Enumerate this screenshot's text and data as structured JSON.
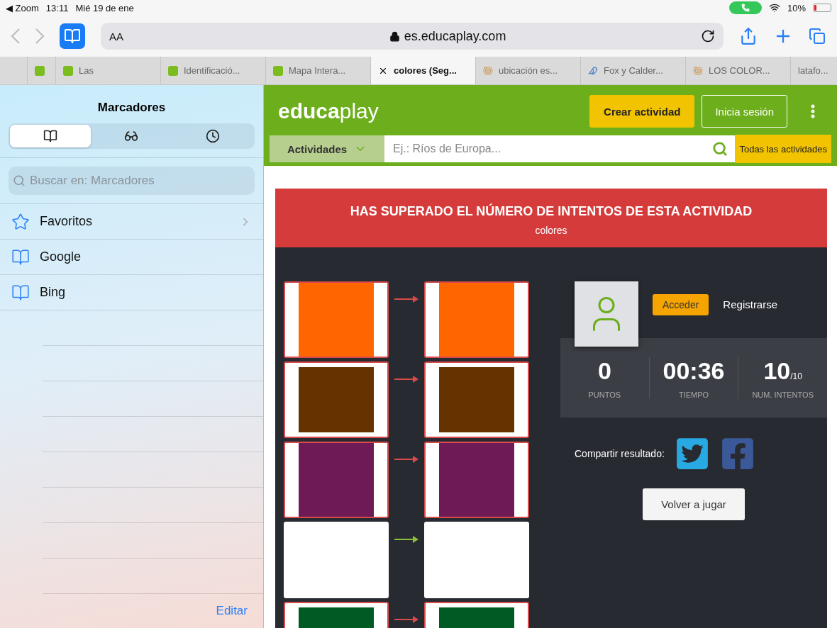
{
  "status_bar": {
    "back_app": "◀ Zoom",
    "time": "13:11",
    "date": "Mié 19 de ene",
    "battery": "10%"
  },
  "toolbar": {
    "text_size": "AA",
    "url": "es.educaplay.com"
  },
  "tabs": [
    {
      "kind": "site",
      "selected": false
    },
    {
      "kind": "site",
      "label": "Las",
      "selected": false
    },
    {
      "kind": "site",
      "label": "Identificació...",
      "selected": false
    },
    {
      "kind": "site",
      "label": "Mapa Intera...",
      "selected": false
    },
    {
      "kind": "closable",
      "label": "colores (Seg...",
      "selected": true
    },
    {
      "kind": "shell",
      "label": "ubicación es...",
      "selected": false
    },
    {
      "kind": "bird",
      "label": "Fox y Calder...",
      "selected": false
    },
    {
      "kind": "shell",
      "label": "LOS COLOR...",
      "selected": false
    },
    {
      "kind": "plain",
      "label": "latafo...",
      "selected": false
    }
  ],
  "sidebar": {
    "title": "Marcadores",
    "segments": [
      {
        "kind": "bookmarks",
        "selected": true
      },
      {
        "kind": "reading",
        "selected": false
      },
      {
        "kind": "history",
        "selected": false
      }
    ],
    "search": {
      "placeholder": "Buscar en: Marcadores"
    },
    "items": [
      {
        "kind": "folder",
        "label": "Favoritos",
        "expandable": true
      },
      {
        "kind": "bookmark",
        "label": "Google",
        "expandable": false
      },
      {
        "kind": "bookmark",
        "label": "Bing",
        "expandable": false
      }
    ],
    "edit": "Editar"
  },
  "site": {
    "logo": "**educa**play",
    "create": "Crear actividad",
    "login": "Inicia sesión",
    "category": "Actividades",
    "search_placeholder": "Ej.: Ríos de Europa...",
    "all": "Todas las actividades"
  },
  "result": {
    "title": "HAS SUPERADO EL NÚMERO DE INTENTOS DE ESTA ACTIVIDAD",
    "subtitle": "colores",
    "pairs": [
      {
        "color": "#ff6600",
        "correct": false
      },
      {
        "color": "#663300",
        "correct": false
      },
      {
        "color": "#6e1a57",
        "correct": false
      },
      {
        "color": "#ffffff",
        "correct": true
      },
      {
        "color": "#005a24",
        "correct": false
      }
    ],
    "access": "Acceder",
    "register": "Registrarse",
    "stats": [
      {
        "value": "0",
        "label": "PUNTOS"
      },
      {
        "value": "00:36",
        "label": "TIEMPO"
      },
      {
        "value": "10",
        "suffix": "/10",
        "label": "NUM. INTENTOS"
      }
    ],
    "share_label": "Compartir resultado:",
    "replay": "Volver a jugar"
  }
}
